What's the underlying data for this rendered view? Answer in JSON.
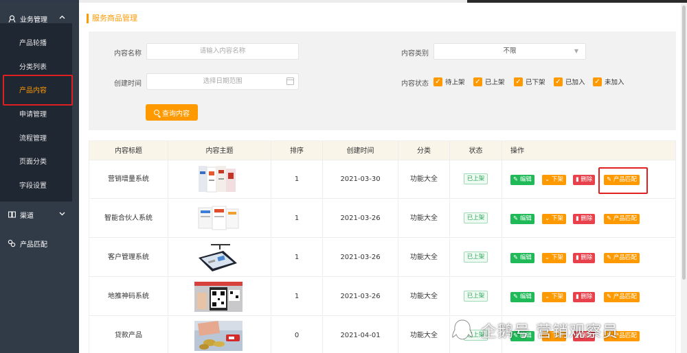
{
  "sidebar": {
    "group_business": {
      "label": "业务管理"
    },
    "items": [
      {
        "label": "产品轮播"
      },
      {
        "label": "分类列表"
      },
      {
        "label": "产品内容"
      },
      {
        "label": "申请管理"
      },
      {
        "label": "流程管理"
      },
      {
        "label": "页面分类"
      },
      {
        "label": "字段设置"
      }
    ],
    "group_channel": {
      "label": "渠道"
    },
    "group_match": {
      "label": "产品匹配"
    }
  },
  "page": {
    "title": "服务商品管理"
  },
  "filters": {
    "name_label": "内容名称",
    "name_placeholder": "请输入内容名称",
    "category_label": "内容类别",
    "category_value": "不限",
    "date_label": "创建时间",
    "date_placeholder": "选择日期范围",
    "status_label": "内容状态",
    "status_options": [
      "待上架",
      "已上架",
      "已下架",
      "已加入",
      "未加入"
    ],
    "query_button": "查询内容"
  },
  "table": {
    "headers": [
      "内容标题",
      "内容主题",
      "排序",
      "创建时间",
      "分类",
      "状态",
      "操作"
    ],
    "rows": [
      {
        "title": "营销增量系统",
        "sort": "1",
        "created": "2021-03-30",
        "category": "功能大全",
        "status": "已上架"
      },
      {
        "title": "智能合伙人系统",
        "sort": "1",
        "created": "2021-03-26",
        "category": "功能大全",
        "status": "已上架"
      },
      {
        "title": "客户管理系统",
        "sort": "1",
        "created": "2021-03-26",
        "category": "功能大全",
        "status": "已上架"
      },
      {
        "title": "地推神码系统",
        "sort": "1",
        "created": "2021-03-26",
        "category": "功能大全",
        "status": "已上架"
      },
      {
        "title": "贷款产品",
        "sort": "0",
        "created": "2021-04-01",
        "category": "功能大全",
        "status": "已上架"
      }
    ],
    "actions": {
      "edit": "编辑",
      "down": "下架",
      "delete": "删除",
      "match": "产品匹配"
    }
  },
  "watermark": {
    "text": "企鹅号 营销观察员"
  },
  "colors": {
    "accent": "#ff9900",
    "sidebar": "#313a47",
    "success": "#1fba57",
    "danger": "#e8414b",
    "highlight": "#e02020"
  }
}
